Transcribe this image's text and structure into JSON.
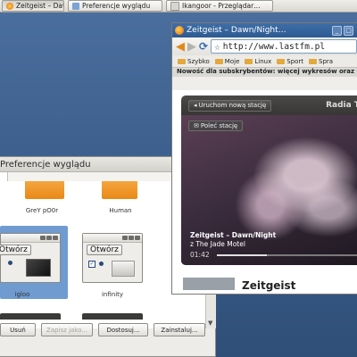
{
  "taskbar": {
    "tasks": [
      {
        "label": "Zeitgeist – Dawn/Nig…",
        "icon": "firefox-icon"
      },
      {
        "label": "Preferencje wyglądu",
        "icon": "appearance-icon"
      },
      {
        "label": "Ikangoor - Przeglądar…",
        "icon": "browser-icon"
      }
    ]
  },
  "appearance": {
    "title": "Preferencje wyglądu",
    "themes": [
      {
        "name": "GreY pO0r"
      },
      {
        "name": "Human"
      },
      {
        "name": "igloo",
        "button": "Otwórz",
        "selected": true
      },
      {
        "name": "infinity",
        "button": "Otwórz"
      }
    ],
    "buttons": {
      "remove": "Usuń",
      "save": "Zapisz jako...",
      "customize": "Dostosuj...",
      "install": "Zainstaluj..."
    }
  },
  "browser": {
    "title": "Zeitgeist – Dawn/Night…",
    "url": "http://www.lastfm.pl",
    "bookmarks": [
      "Szybko",
      "Moje",
      "Linux",
      "Sport",
      "Spra"
    ],
    "notice": "Nowość dla subskrybentów: więcej wykresów oraz w",
    "player": {
      "new_station": "Uruchom nową stację",
      "radio_title": "Radia T",
      "recommend": "Poleć stację",
      "track_title": "Zeitgeist – Dawn/Night",
      "track_artist": "z The Jade Motel",
      "time": "01:42",
      "progress": 0.35
    },
    "heading": "Zeitgeist"
  },
  "colors": {
    "desktop": "#3d5f8d",
    "selection": "#6f9bd0",
    "titlebar": "#2d5a91",
    "accent_orange": "#e88916"
  }
}
